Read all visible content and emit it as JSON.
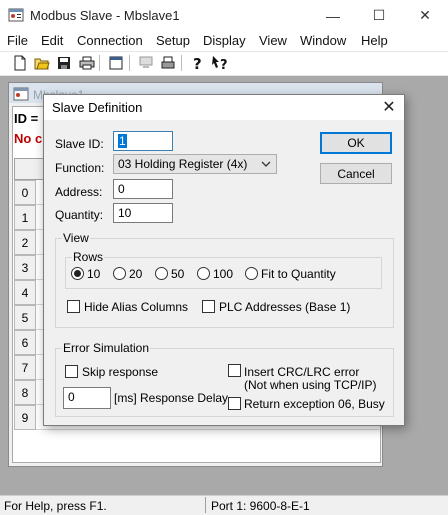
{
  "window": {
    "title": "Modbus Slave - Mbslave1",
    "minimize": "—",
    "maximize": "☐",
    "close": "✕"
  },
  "menu": [
    "File",
    "Edit",
    "Connection",
    "Setup",
    "Display",
    "View",
    "Window",
    "Help"
  ],
  "child": {
    "title": "Mbslave1",
    "id_text": "ID = ",
    "noconn_text": "No c",
    "rows": [
      "0",
      "1",
      "2",
      "3",
      "4",
      "5",
      "6",
      "7",
      "8",
      "9"
    ]
  },
  "status": {
    "left": "For Help, press F1.",
    "right": "Port 1: 9600-8-E-1"
  },
  "dialog": {
    "title": "Slave Definition",
    "close": "✕",
    "slave_id_label": "Slave ID:",
    "slave_id_value": "1",
    "function_label": "Function:",
    "function_value": "03 Holding Register (4x)",
    "address_label": "Address:",
    "address_value": "0",
    "quantity_label": "Quantity:",
    "quantity_value": "10",
    "ok_label": "OK",
    "cancel_label": "Cancel",
    "view_group": "View",
    "rows_group": "Rows",
    "rows_options": [
      "10",
      "20",
      "50",
      "100",
      "Fit to Quantity"
    ],
    "rows_selected": "10",
    "hide_alias_label": "Hide Alias Columns",
    "plc_addresses_label": "PLC Addresses (Base 1)",
    "error_group": "Error Simulation",
    "skip_response_label": "Skip response",
    "delay_value": "0",
    "delay_label": "[ms] Response Delay",
    "insert_crc_label": "Insert CRC/LRC error",
    "insert_crc_note": "(Not when using TCP/IP)",
    "return_exception_label": "Return exception 06, Busy"
  },
  "colors": {
    "accent": "#0078d7",
    "error_text": "#c00000",
    "workspace": "#a9a9a9"
  }
}
